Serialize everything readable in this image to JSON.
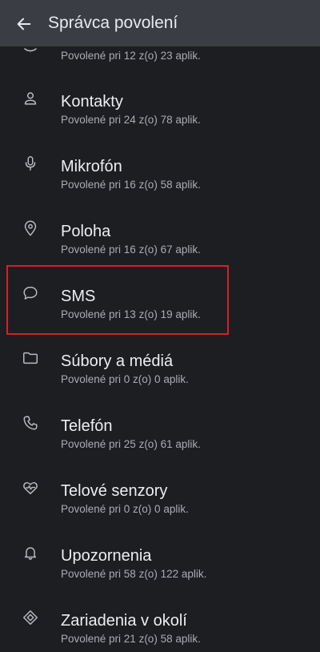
{
  "header": {
    "title": "Správca povolení",
    "back_icon": "arrow-back-icon"
  },
  "colors": {
    "header_bg": "#3a3d44",
    "page_bg": "#1d1e22",
    "title_text": "#eceef1",
    "summary_text": "#a9acb2",
    "highlight": "#d42027"
  },
  "partial_item": {
    "summary": "Povolené pri 12 z(o) 23 aplik."
  },
  "items": [
    {
      "title": "Kontakty",
      "summary": "Povolené pri 24 z(o) 78 aplik.",
      "icon": "person-icon"
    },
    {
      "title": "Mikrofón",
      "summary": "Povolené pri 16 z(o) 58 aplik.",
      "icon": "microphone-icon"
    },
    {
      "title": "Poloha",
      "summary": "Povolené pri 16 z(o) 67 aplik.",
      "icon": "location-pin-icon"
    },
    {
      "title": "SMS",
      "summary": "Povolené pri 13 z(o) 19 aplik.",
      "icon": "chat-bubble-icon"
    },
    {
      "title": "Súbory a médiá",
      "summary": "Povolené pri 0 z(o) 0 aplik.",
      "icon": "folder-icon"
    },
    {
      "title": "Telefón",
      "summary": "Povolené pri 25 z(o) 61 aplik.",
      "icon": "phone-icon"
    },
    {
      "title": "Telové senzory",
      "summary": "Povolené pri 0 z(o) 0 aplik.",
      "icon": "heart-pulse-icon"
    },
    {
      "title": "Upozornenia",
      "summary": "Povolené pri 58 z(o) 122 aplik.",
      "icon": "bell-icon"
    },
    {
      "title": "Zariadenia v okolí",
      "summary": "Povolené pri 21 z(o) 58 aplik.",
      "icon": "nearby-devices-icon"
    }
  ]
}
